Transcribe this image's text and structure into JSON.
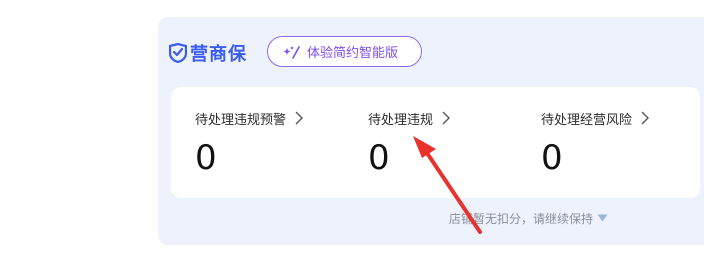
{
  "brand": {
    "name": "营商保",
    "logo_icon": "shield-check-icon",
    "color": "#3b5cf0"
  },
  "edition_button": {
    "label": "体验简约智能版",
    "icon": "sparkle-icon",
    "accent": "#7d4ff0"
  },
  "metrics": [
    {
      "title": "待处理违规预警",
      "value": "0"
    },
    {
      "title": "待处理违规",
      "value": "0"
    },
    {
      "title": "待处理经营风险",
      "value": "0"
    }
  ],
  "footer_note": {
    "text": "店铺暂无扣分，请继续保持",
    "icon": "caret-down-icon"
  },
  "annotation": {
    "type": "red-arrow",
    "color": "#e8322b"
  }
}
